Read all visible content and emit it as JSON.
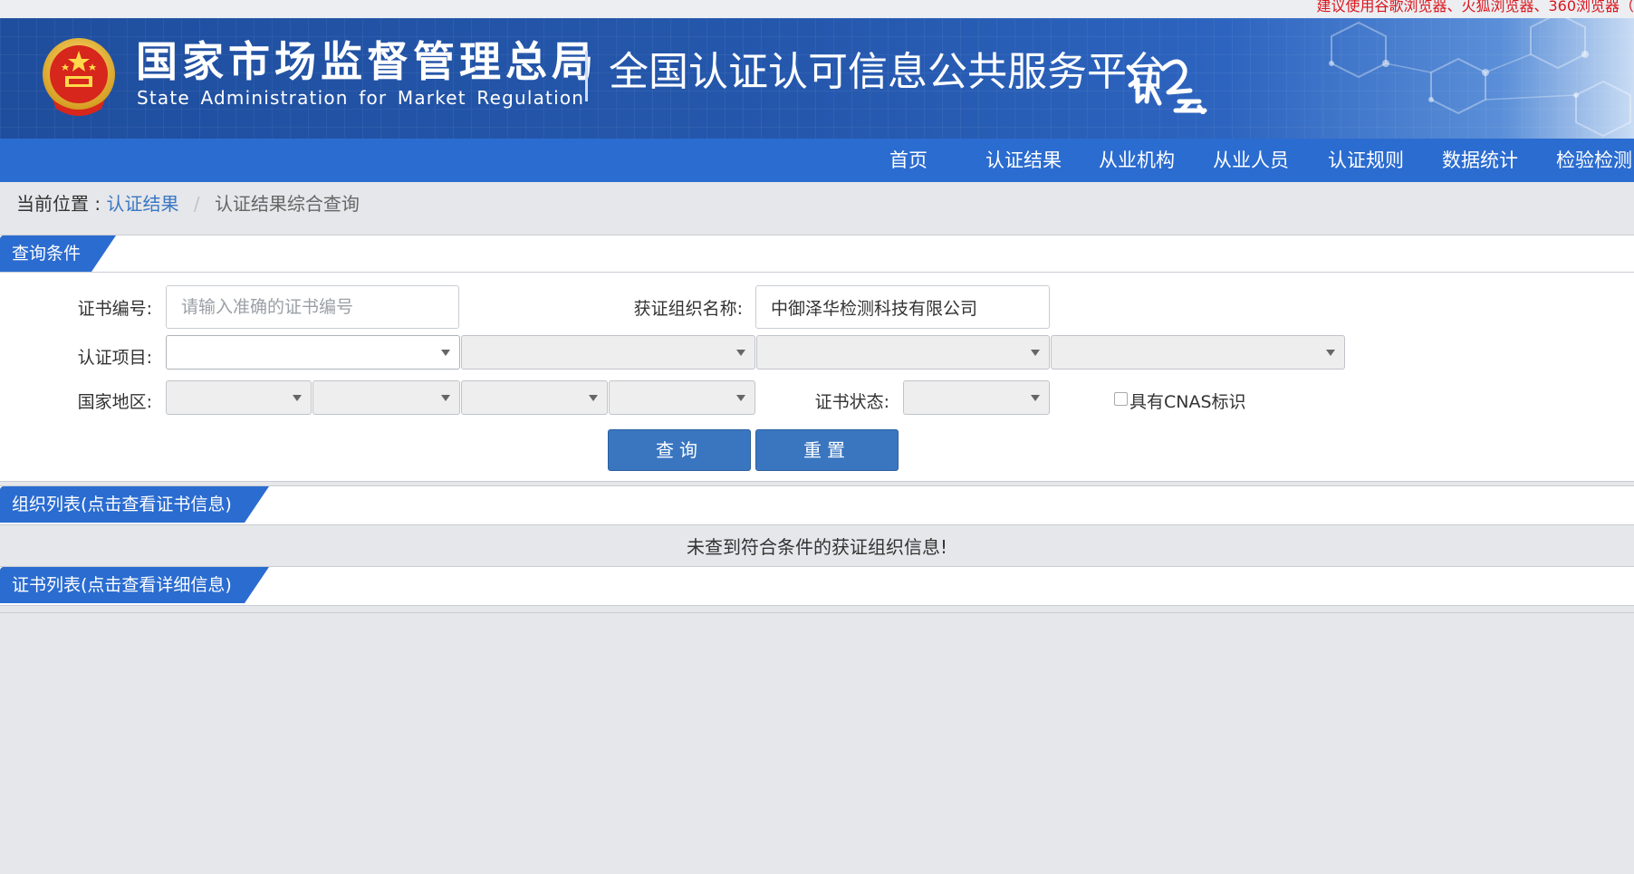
{
  "notice": "建议使用谷歌浏览器、火狐浏览器、360浏览器（",
  "header": {
    "agency_cn": "国家市场监督管理总局",
    "agency_en": "State Administration  for  Market Regulation",
    "platform": "全国认证认可信息公共服务平台"
  },
  "nav": [
    "首页",
    "认证结果",
    "从业机构",
    "从业人员",
    "认证规则",
    "数据统计",
    "检验检测"
  ],
  "breadcrumb": {
    "label": "当前位置 :",
    "link": "认证结果",
    "separator": "/",
    "current": "认证结果综合查询"
  },
  "query": {
    "title": "查询条件",
    "cert_no_label": "证书编号:",
    "cert_no_placeholder": "请输入准确的证书编号",
    "org_name_label": "获证组织名称:",
    "org_name_value": "中御泽华检测科技有限公司",
    "project_label": "认证项目:",
    "region_label": "国家地区:",
    "status_label": "证书状态:",
    "cnas_label": "具有CNAS标识",
    "search_button": "查询",
    "reset_button": "重置"
  },
  "org_list": {
    "title": "组织列表(点击查看证书信息)",
    "empty_message": "未查到符合条件的获证组织信息!"
  },
  "cert_list": {
    "title": "证书列表(点击查看详细信息)"
  },
  "colors": {
    "nav_blue": "#2b6cd0",
    "banner_blue": "#2558ad",
    "button_blue": "#3a76c0",
    "link_blue": "#3a78c4",
    "notice_red": "#d9161c"
  }
}
